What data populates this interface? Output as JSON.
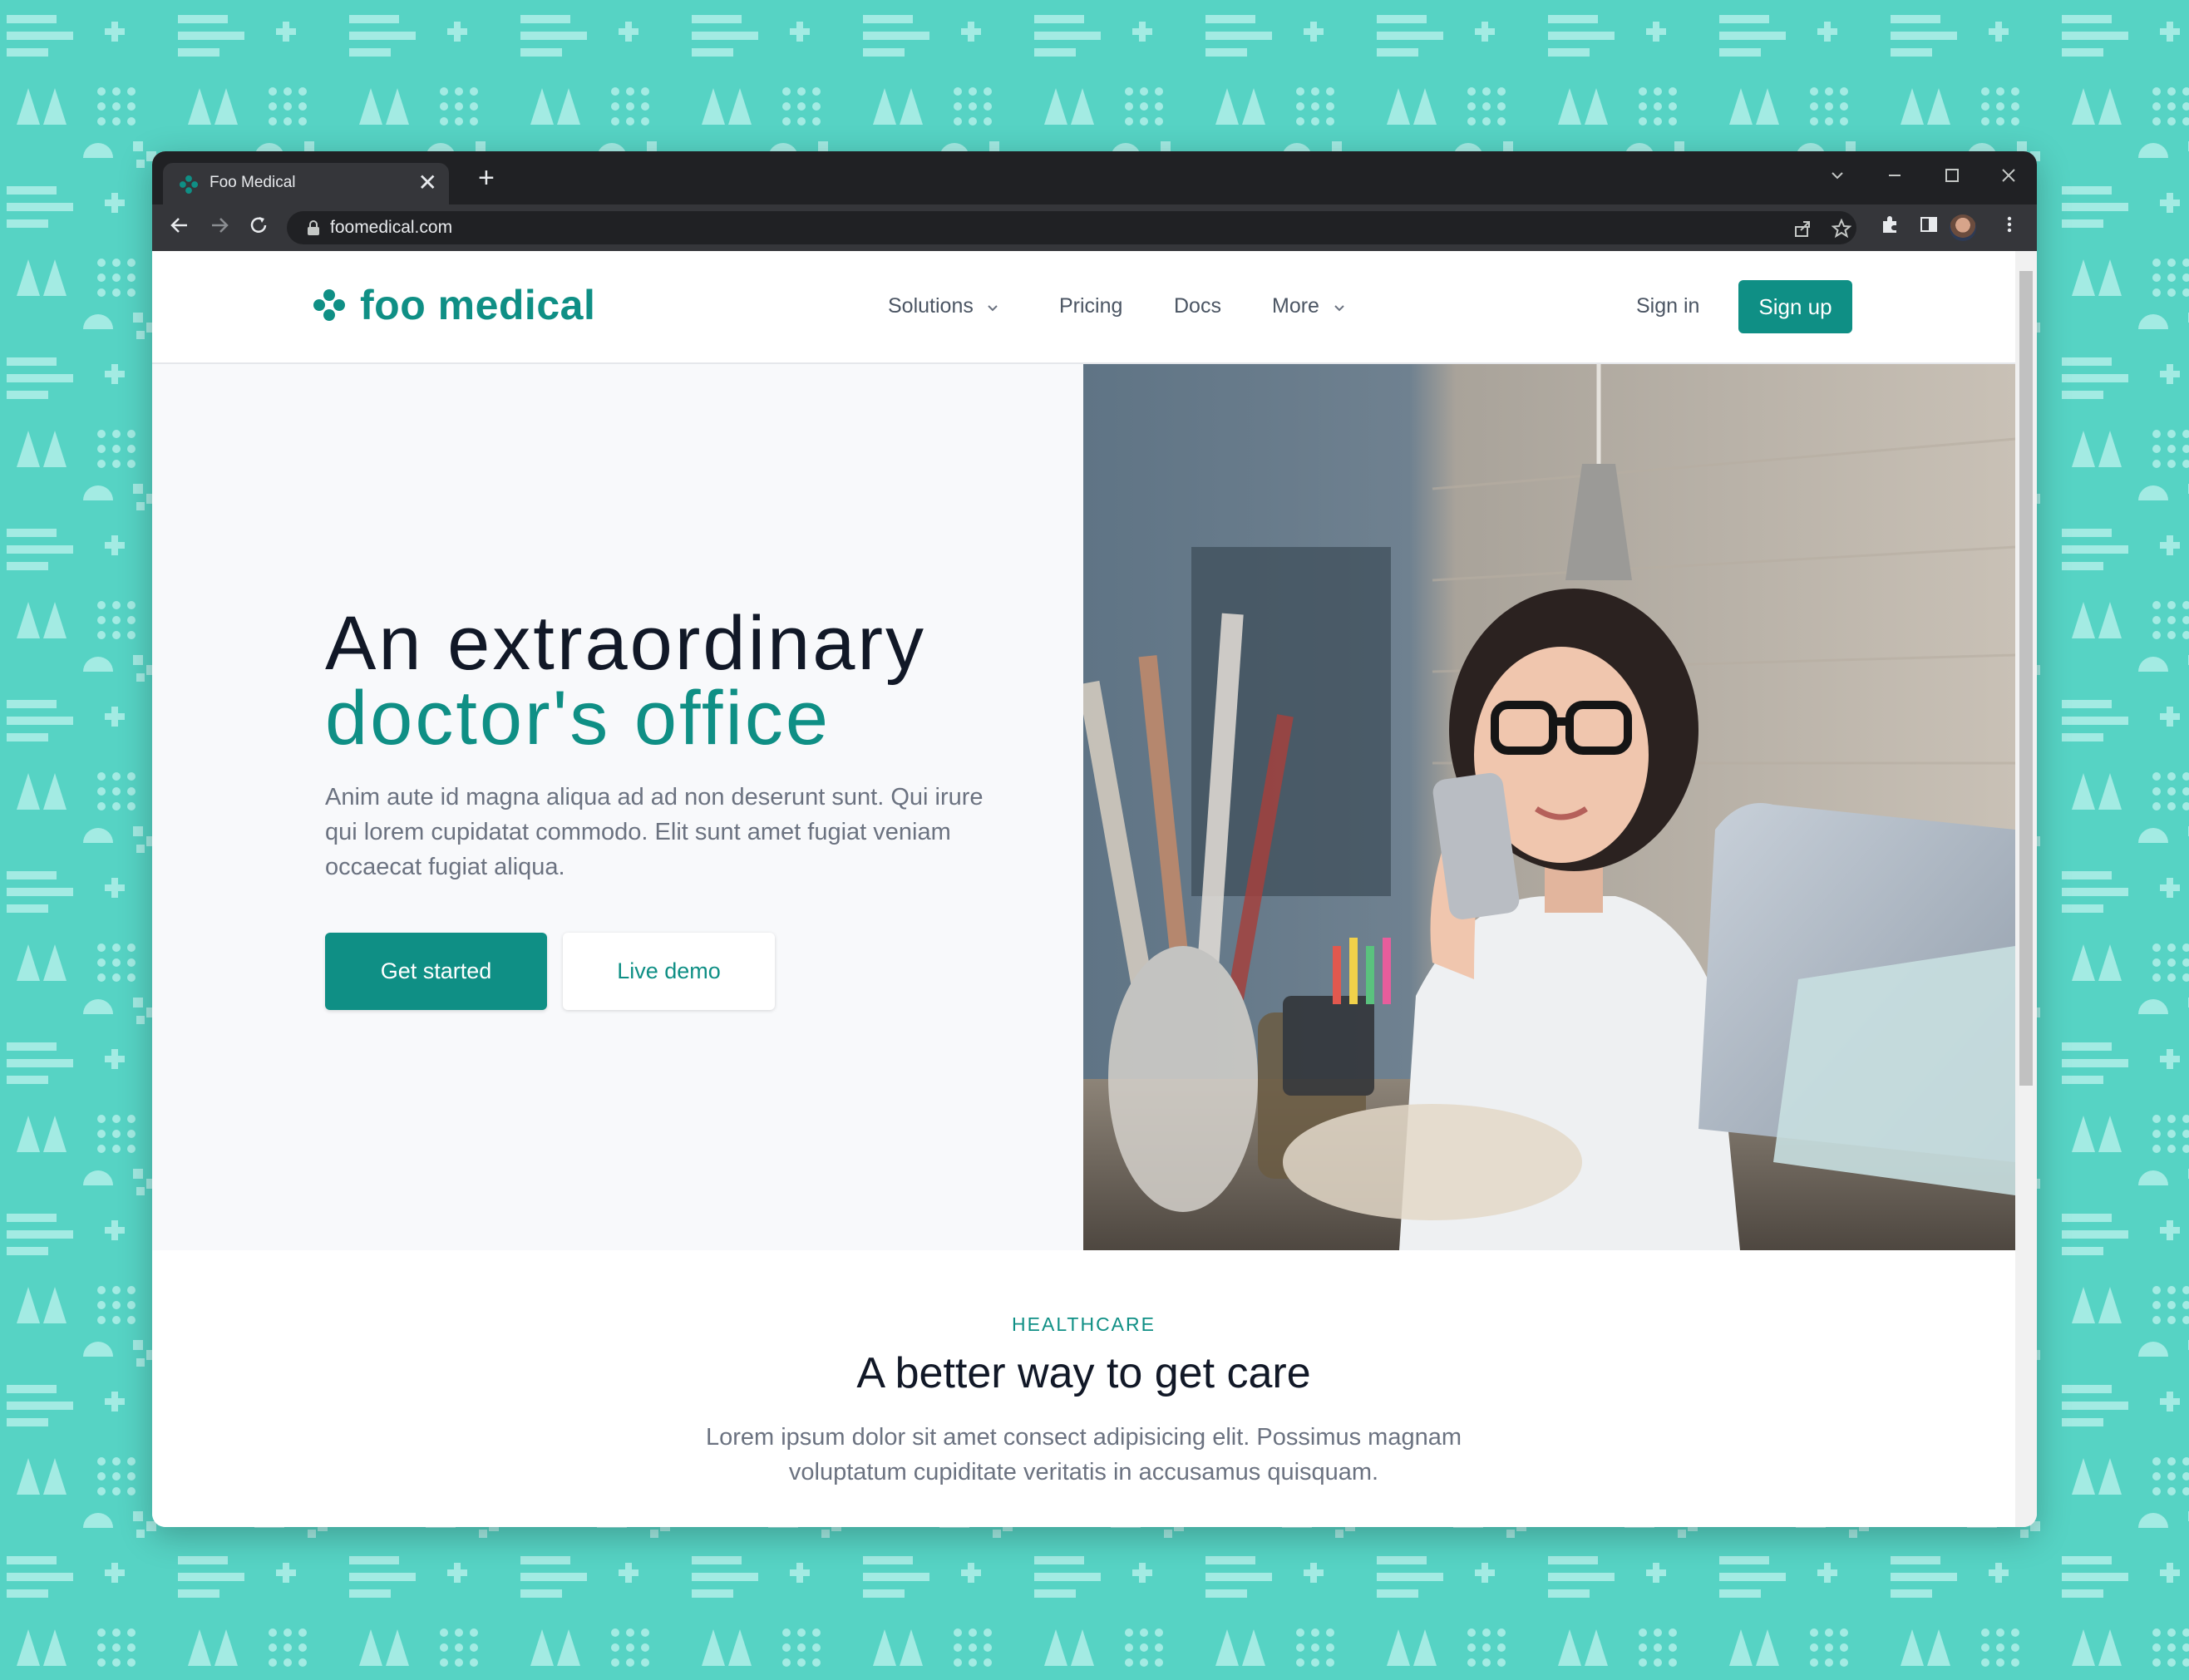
{
  "browser": {
    "tab_title": "Foo Medical",
    "tab_close": "✕",
    "new_tab": "+",
    "url": "foomedical.com",
    "icons": [
      "back-icon",
      "forward-icon",
      "reload-icon",
      "lock-icon",
      "share-icon",
      "star-icon",
      "extensions-icon",
      "side-panel-icon",
      "profile-avatar",
      "menu-icon",
      "tab-search-icon",
      "minimize-icon",
      "maximize-icon",
      "close-window-icon"
    ]
  },
  "header": {
    "logo_text": "foo medical",
    "nav": {
      "solutions": "Solutions",
      "pricing": "Pricing",
      "docs": "Docs",
      "more": "More"
    },
    "sign_in": "Sign in",
    "sign_up": "Sign up"
  },
  "hero": {
    "title_line1": "An extraordinary",
    "title_line2": "doctor's office",
    "body": "Anim aute id magna aliqua ad ad non deserunt sunt. Qui irure qui lorem cupidatat commodo. Elit sunt amet fugiat veniam occaecat fugiat aliqua.",
    "get_started": "Get started",
    "live_demo": "Live demo"
  },
  "section": {
    "eyebrow": "HEALTHCARE",
    "title": "A better way to get care",
    "body": "Lorem ipsum dolor sit amet consect adipisicing elit. Possimus magnam voluptatum cupiditate veritatis in accusamus quisquam."
  },
  "colors": {
    "brand": "#0f8f85",
    "background": "#56d3c4",
    "pattern": "#9ee8df"
  }
}
